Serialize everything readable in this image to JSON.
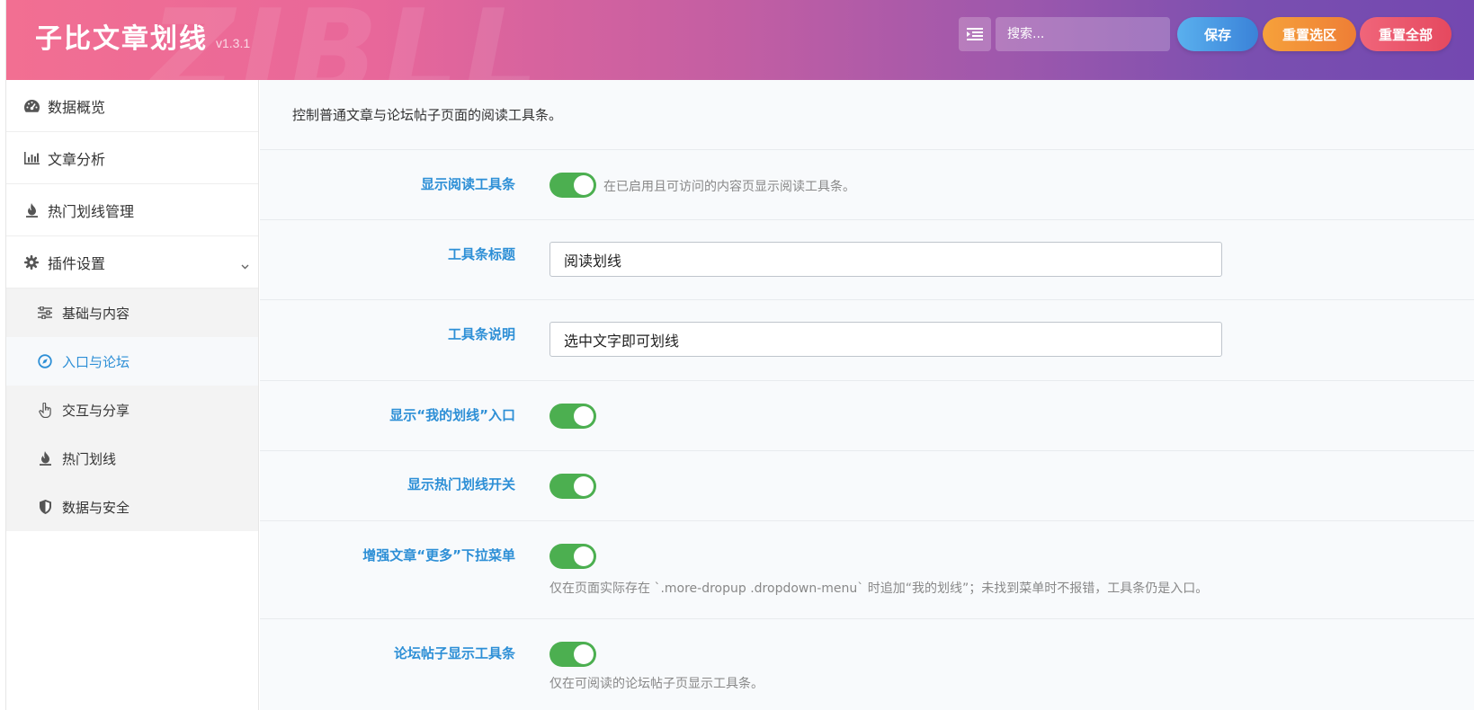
{
  "header": {
    "title": "子比文章划线",
    "version": "v1.3.1",
    "search_placeholder": "搜索...",
    "buttons": {
      "save": "保存",
      "reset_section": "重置选区",
      "reset_all": "重置全部"
    },
    "colors": {
      "gradient_start": "#f26f92",
      "gradient_end": "#7348b0",
      "save": "#3a82d8",
      "reset_section": "#ee7e36",
      "reset_all": "#e5495f"
    },
    "icons": {
      "menu_toggle": "list-indent-icon"
    }
  },
  "sidebar": {
    "items": [
      {
        "label": "数据概览",
        "icon": "dashboard-icon"
      },
      {
        "label": "文章分析",
        "icon": "bar-chart-icon"
      },
      {
        "label": "热门划线管理",
        "icon": "fire-icon"
      },
      {
        "label": "插件设置",
        "icon": "gear-icon",
        "expanded": true
      }
    ],
    "subitems": [
      {
        "label": "基础与内容",
        "icon": "sliders-icon"
      },
      {
        "label": "入口与论坛",
        "icon": "compass-icon",
        "active": true
      },
      {
        "label": "交互与分享",
        "icon": "hand-pointer-icon"
      },
      {
        "label": "热门划线",
        "icon": "fire-icon"
      },
      {
        "label": "数据与安全",
        "icon": "shield-icon"
      }
    ]
  },
  "main": {
    "description": "控制普通文章与论坛帖子页面的阅读工具条。",
    "accent_color": "#2d8fd6",
    "toggle_color": "#4caf50",
    "fields": {
      "show_toolbar": {
        "label": "显示阅读工具条",
        "on": true,
        "help": "在已启用且可访问的内容页显示阅读工具条。"
      },
      "toolbar_title": {
        "label": "工具条标题",
        "value": "阅读划线"
      },
      "toolbar_desc": {
        "label": "工具条说明",
        "value": "选中文字即可划线"
      },
      "show_my_entry": {
        "label": "显示“我的划线”入口",
        "on": true
      },
      "show_hot_switch": {
        "label": "显示热门划线开关",
        "on": true
      },
      "enhance_more_menu": {
        "label": "增强文章“更多”下拉菜单",
        "on": true,
        "help": "仅在页面实际存在 `.more-dropup .dropdown-menu` 时追加“我的划线”；未找到菜单时不报错，工具条仍是入口。"
      },
      "forum_toolbar": {
        "label": "论坛帖子显示工具条",
        "on": true,
        "help": "仅在可阅读的论坛帖子页显示工具条。"
      }
    }
  }
}
